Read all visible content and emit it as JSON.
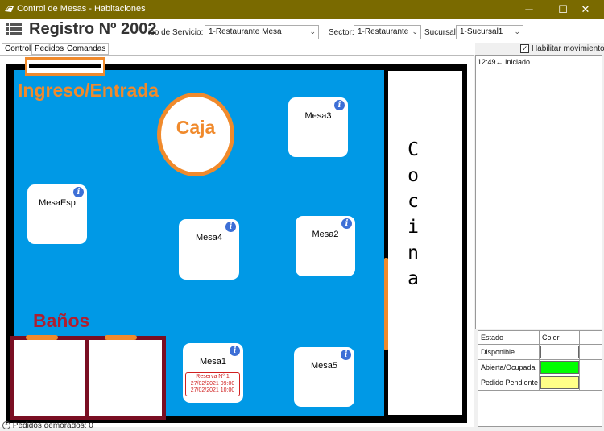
{
  "window": {
    "title": "Control de Mesas - Habitaciones",
    "minimize": "─",
    "maximize": "☐",
    "close": "✕"
  },
  "header": {
    "registro": "Registro Nº 2002",
    "tipo_servicio_label": "ipo de Servicio:",
    "tipo_servicio_value": "1-Restaurante Mesa",
    "sector_label": "Sector:",
    "sector_value": "1-Restaurante",
    "sucursal_label": "Sucursal:",
    "sucursal_value": "1-Sucursal1",
    "habilitar_label": "Habilitar movimiento",
    "habilitar_checked": "✓"
  },
  "tabs": [
    "Control",
    "Pedidos",
    "Comandas"
  ],
  "floor": {
    "ingreso": "Ingreso/Entrada",
    "caja": "Caja",
    "banos": "Baños",
    "cocina_letters": [
      "C",
      "o",
      "c",
      "i",
      "n",
      "a"
    ]
  },
  "mesas": [
    {
      "name": "Mesa3"
    },
    {
      "name": "MesaEsp"
    },
    {
      "name": "Mesa4"
    },
    {
      "name": "Mesa2"
    },
    {
      "name": "Mesa1",
      "reserva": [
        "Reserva Nº 1",
        "27/02/2021 09:00",
        "27/02/2021 10:00"
      ]
    },
    {
      "name": "Mesa5"
    }
  ],
  "info_glyph": "i",
  "log": [
    "12:49← Iniciado"
  ],
  "legend": {
    "headers": [
      "Estado",
      "Color"
    ],
    "rows": [
      {
        "estado": "Disponible",
        "color": "#ffffff"
      },
      {
        "estado": "Abierta/Ocupada",
        "color": "#00ff00"
      },
      {
        "estado": "Pedido Pendiente",
        "color": "#ffff88"
      }
    ]
  },
  "status": {
    "icon": "^",
    "text": "Pedidos demorados: 0"
  },
  "colors": {
    "titlebar": "#7a6a00",
    "salon": "#0099e6",
    "accent": "#f08a2c",
    "bano_border": "#7a0e22",
    "info": "#3d6fd6"
  }
}
